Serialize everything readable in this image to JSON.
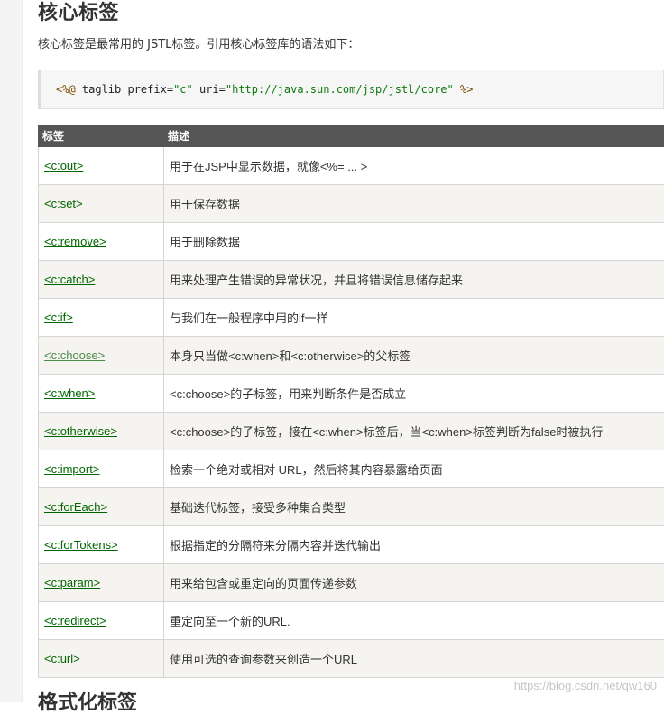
{
  "section": {
    "title": "核心标签",
    "intro": "核心标签是最常用的 JSTL标签。引用核心标签库的语法如下："
  },
  "code": {
    "open": "<%@",
    "keyword": " taglib ",
    "attr1": "prefix=",
    "val1": "\"c\"",
    "attr2": " uri=",
    "val2": "\"http://java.sun.com/jsp/jstl/core\"",
    "close": " %>"
  },
  "table": {
    "headers": [
      "标签",
      "描述"
    ],
    "rows": [
      {
        "tag": "<c:out>",
        "desc": "用于在JSP中显示数据，就像<%= ... >"
      },
      {
        "tag": "<c:set>",
        "desc": "用于保存数据"
      },
      {
        "tag": "<c:remove>",
        "desc": "用于删除数据"
      },
      {
        "tag": "<c:catch>",
        "desc": "用来处理产生错误的异常状况，并且将错误信息储存起来"
      },
      {
        "tag": "<c:if>",
        "desc": "与我们在一般程序中用的if一样"
      },
      {
        "tag": "<c:choose>",
        "desc": "本身只当做<c:when>和<c:otherwise>的父标签"
      },
      {
        "tag": "<c:when>",
        "desc": "<c:choose>的子标签，用来判断条件是否成立"
      },
      {
        "tag": "<c:otherwise>",
        "desc": "<c:choose>的子标签，接在<c:when>标签后，当<c:when>标签判断为false时被执行"
      },
      {
        "tag": "<c:import>",
        "desc": "检索一个绝对或相对 URL，然后将其内容暴露给页面"
      },
      {
        "tag": "<c:forEach>",
        "desc": "基础迭代标签，接受多种集合类型"
      },
      {
        "tag": "<c:forTokens>",
        "desc": "根据指定的分隔符来分隔内容并迭代输出"
      },
      {
        "tag": "<c:param>",
        "desc": "用来给包含或重定向的页面传递参数"
      },
      {
        "tag": "<c:redirect>",
        "desc": "重定向至一个新的URL."
      },
      {
        "tag": "<c:url>",
        "desc": "使用可选的查询参数来创造一个URL"
      }
    ]
  },
  "next_section": {
    "title": "格式化标签"
  },
  "watermark": "https://blog.csdn.net/qw160",
  "colors": {
    "header_bg": "#555555",
    "link": "#006600",
    "visited_link": "#4d8b4d",
    "even_row": "#f6f4f0"
  }
}
